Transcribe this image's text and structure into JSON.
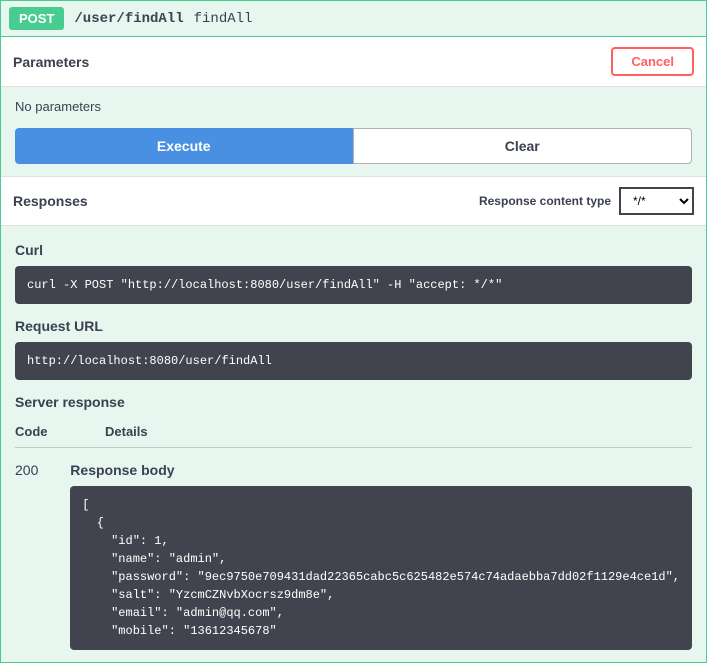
{
  "op": {
    "method": "POST",
    "path": "/user/findAll",
    "summary": "findAll"
  },
  "parameters": {
    "heading": "Parameters",
    "cancel": "Cancel",
    "empty": "No parameters",
    "execute": "Execute",
    "clear": "Clear"
  },
  "responses": {
    "heading": "Responses",
    "ct_label": "Response content type",
    "ct_value": "*/*",
    "curl_heading": "Curl",
    "curl": "curl -X POST \"http://localhost:8080/user/findAll\" -H \"accept: */*\"",
    "url_heading": "Request URL",
    "url": "http://localhost:8080/user/findAll",
    "server_heading": "Server response",
    "col_code": "Code",
    "col_details": "Details",
    "status": "200",
    "body_heading": "Response body",
    "body": "[\n  {\n    \"id\": 1,\n    \"name\": \"admin\",\n    \"password\": \"9ec9750e709431dad22365cabc5c625482e574c74adaebba7dd02f1129e4ce1d\",\n    \"salt\": \"YzcmCZNvbXocrsz9dm8e\",\n    \"email\": \"admin@qq.com\",\n    \"mobile\": \"13612345678\""
  }
}
